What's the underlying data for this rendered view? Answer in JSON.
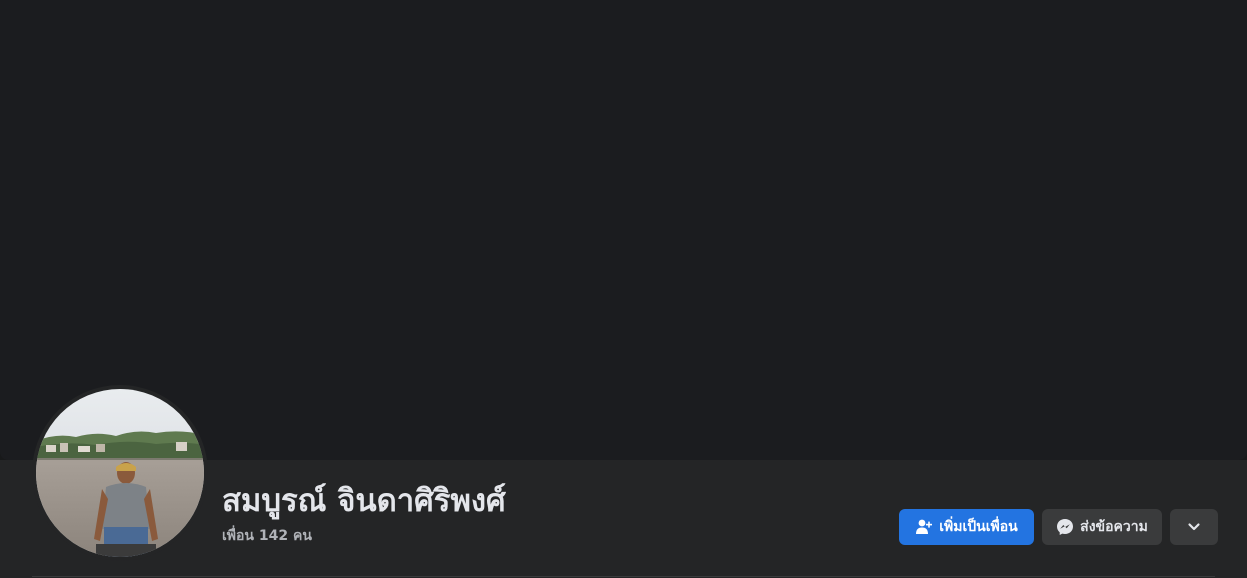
{
  "profile": {
    "name": "สมบูรณ์ จินดาศิริพงศ์",
    "friends_text": "เพื่อน 142 คน"
  },
  "actions": {
    "add_friend_label": "เพิ่มเป็นเพื่อน",
    "message_label": "ส่งข้อความ",
    "more_icon": "chevron-down-icon"
  },
  "colors": {
    "primary": "#2374e1",
    "secondary_button": "#3a3b3c",
    "text_primary": "#e4e6eb",
    "text_secondary": "#b0b3b8"
  }
}
